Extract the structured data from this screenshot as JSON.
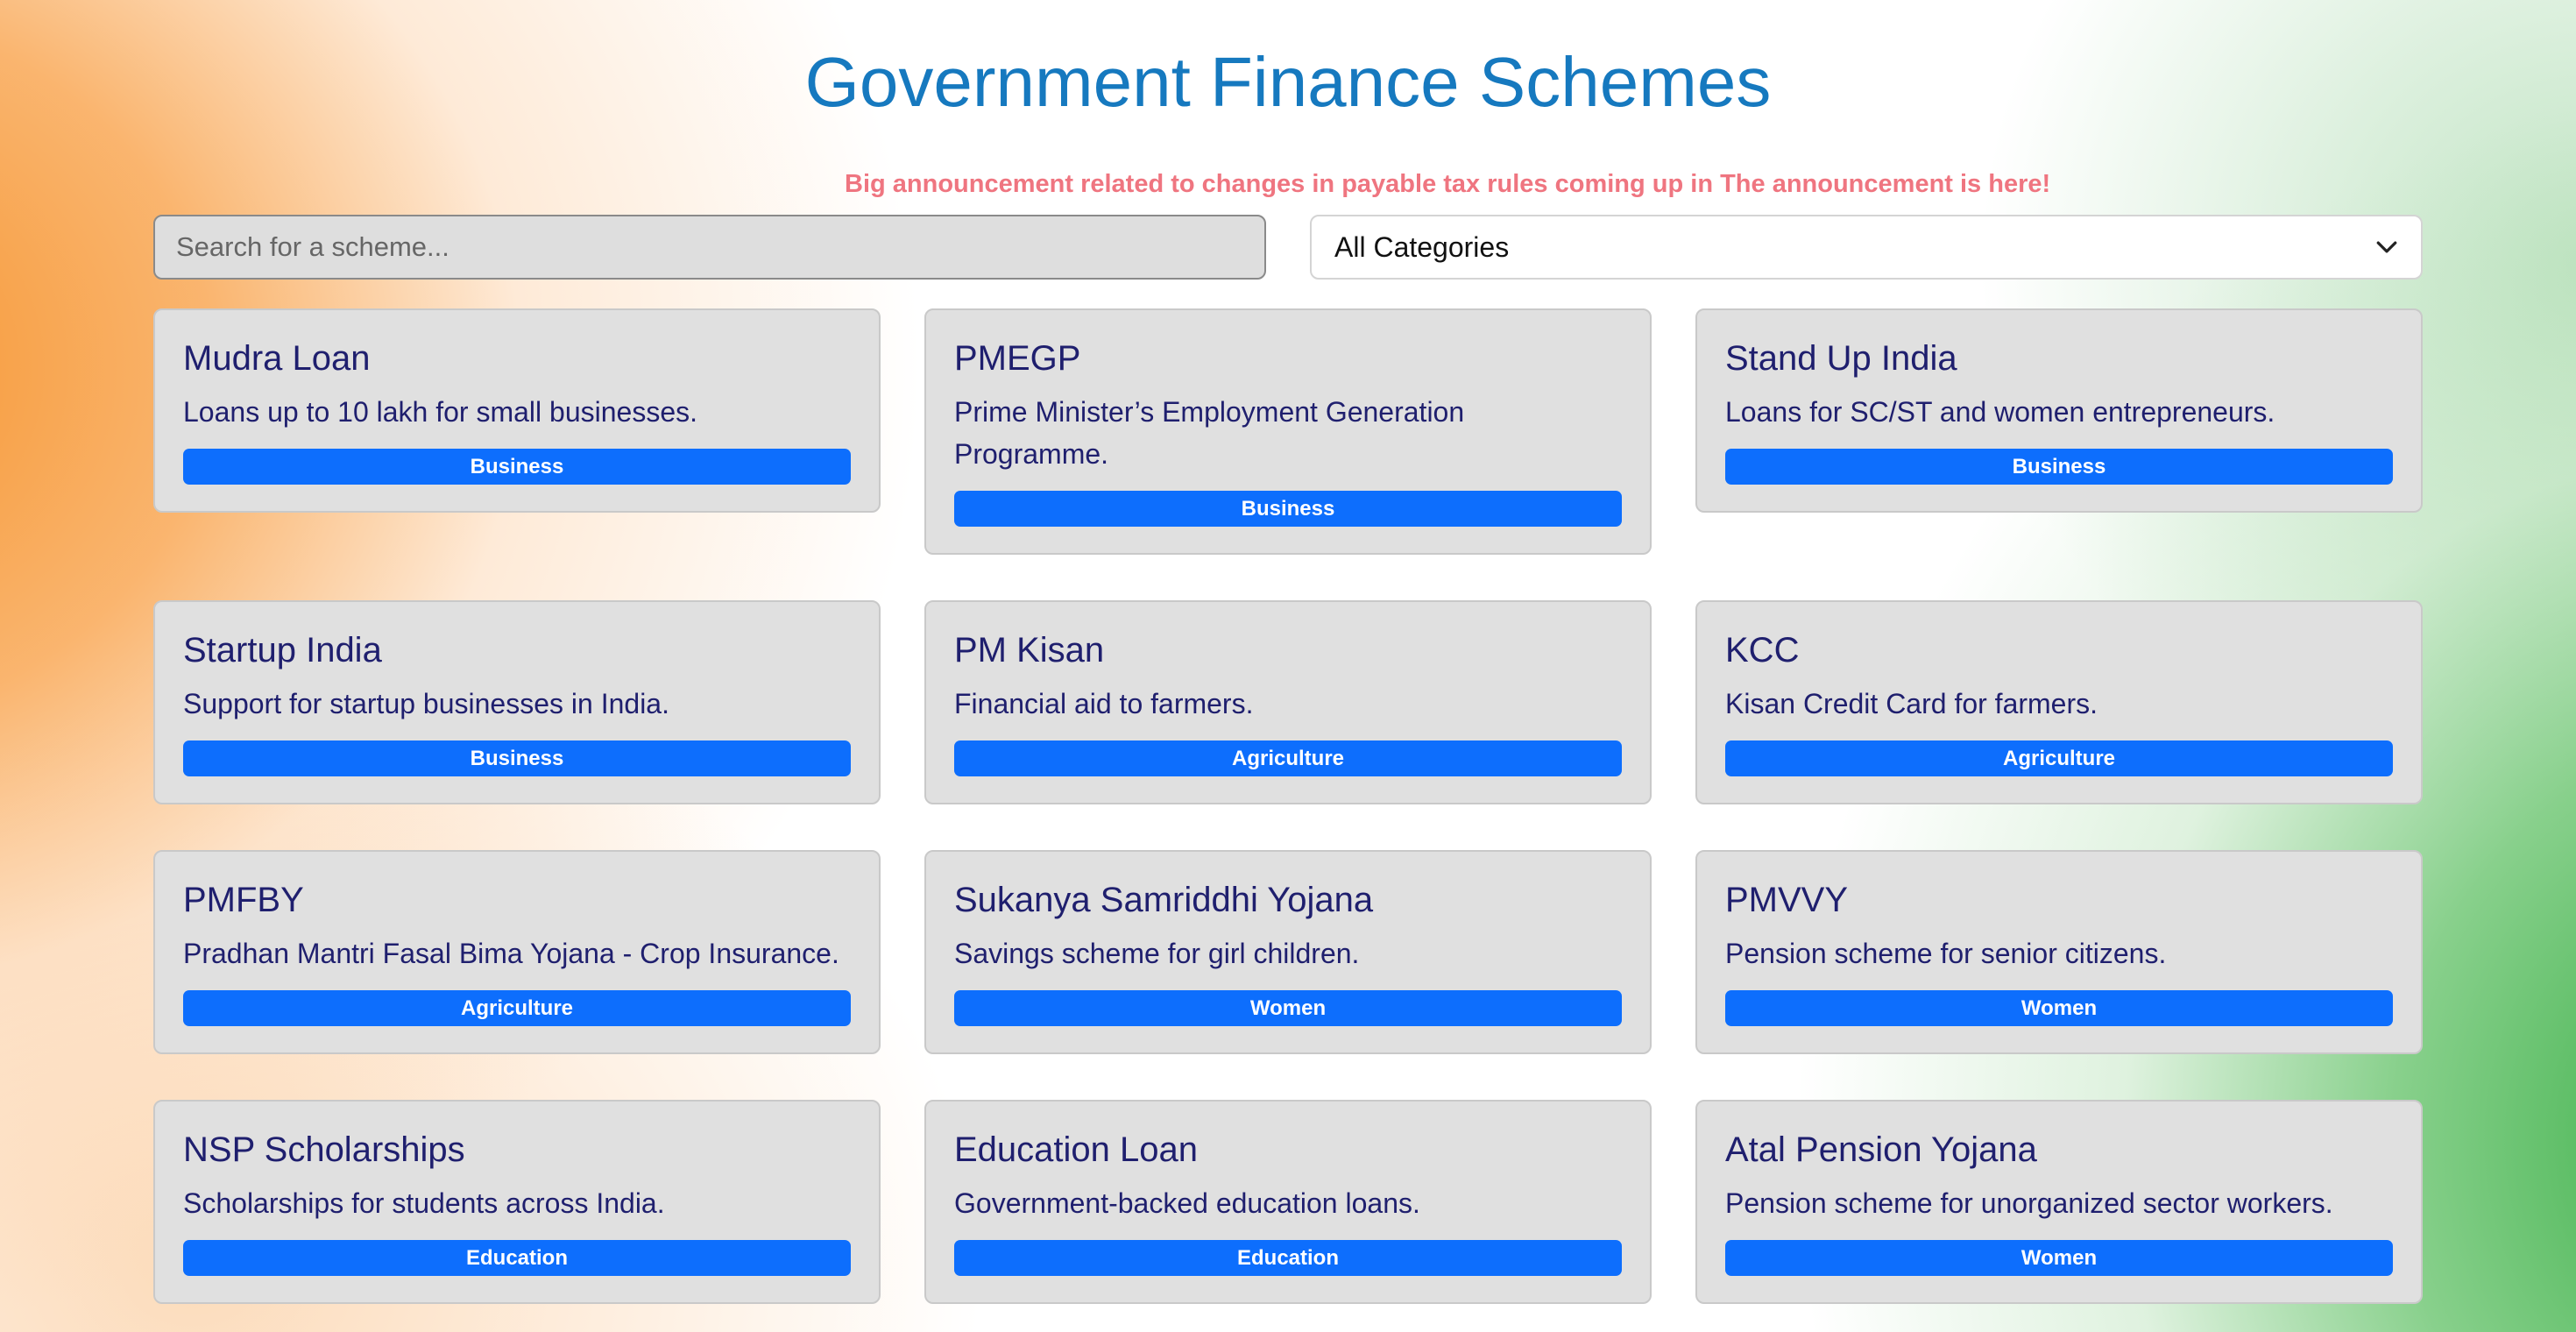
{
  "header": {
    "title": "Government Finance Schemes",
    "announcement": "Big announcement related to changes in payable tax rules coming up in The announcement is here!"
  },
  "filters": {
    "search_placeholder": "Search for a scheme...",
    "category_selected": "All Categories"
  },
  "colors": {
    "title": "#1679bf",
    "announcement": "#ef7580",
    "badge": "#0d6efd",
    "card_text": "#1f1f6e",
    "saffron": "#f68c1e",
    "green": "#2eaa3c"
  },
  "schemes": [
    {
      "title": "Mudra Loan",
      "description": "Loans up to 10 lakh for small businesses.",
      "category": "Business"
    },
    {
      "title": "PMEGP",
      "description": "Prime Minister’s Employment Generation Programme.",
      "category": "Business"
    },
    {
      "title": "Stand Up India",
      "description": "Loans for SC/ST and women entrepreneurs.",
      "category": "Business"
    },
    {
      "title": "Startup India",
      "description": "Support for startup businesses in India.",
      "category": "Business"
    },
    {
      "title": "PM Kisan",
      "description": "Financial aid to farmers.",
      "category": "Agriculture"
    },
    {
      "title": "KCC",
      "description": "Kisan Credit Card for farmers.",
      "category": "Agriculture"
    },
    {
      "title": "PMFBY",
      "description": "Pradhan Mantri Fasal Bima Yojana - Crop Insurance.",
      "category": "Agriculture"
    },
    {
      "title": "Sukanya Samriddhi Yojana",
      "description": "Savings scheme for girl children.",
      "category": "Women"
    },
    {
      "title": "PMVVY",
      "description": "Pension scheme for senior citizens.",
      "category": "Women"
    },
    {
      "title": "NSP Scholarships",
      "description": "Scholarships for students across India.",
      "category": "Education"
    },
    {
      "title": "Education Loan",
      "description": "Government-backed education loans.",
      "category": "Education"
    },
    {
      "title": "Atal Pension Yojana",
      "description": "Pension scheme for unorganized sector workers.",
      "category": "Women"
    }
  ]
}
